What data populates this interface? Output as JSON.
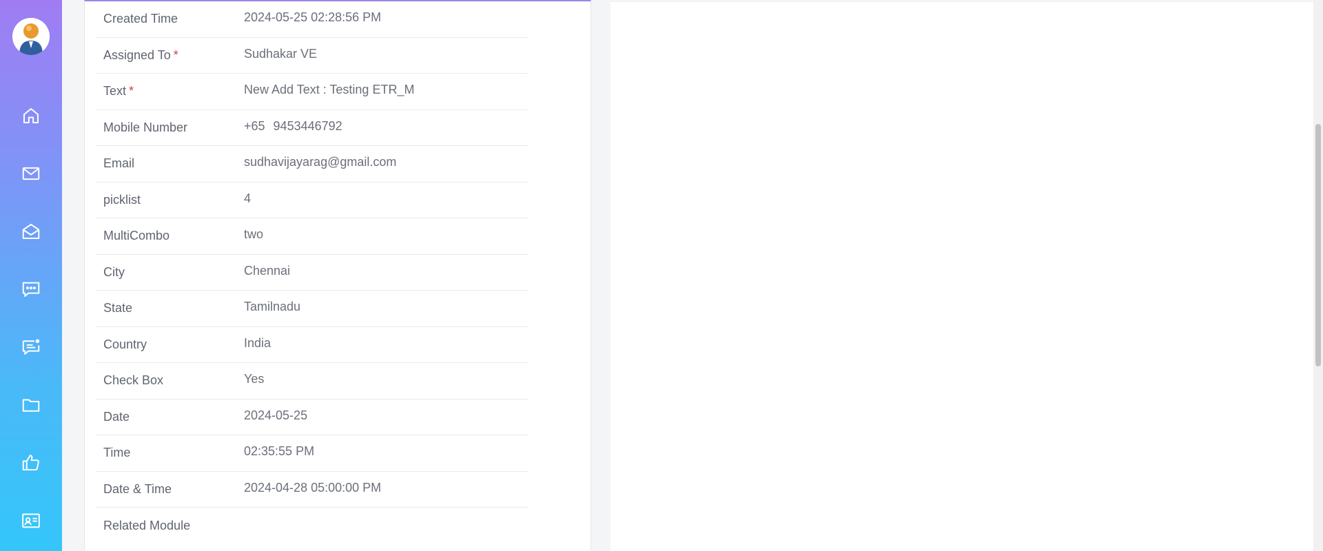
{
  "sidebar": {
    "items": [
      {
        "icon": "home-icon"
      },
      {
        "icon": "mail-icon"
      },
      {
        "icon": "mail-open-icon"
      },
      {
        "icon": "chat-icon"
      },
      {
        "icon": "notification-chat-icon"
      },
      {
        "icon": "folder-icon"
      },
      {
        "icon": "thumbs-up-icon"
      },
      {
        "icon": "contact-card-icon"
      }
    ]
  },
  "details": {
    "rows": [
      {
        "label": "Created Time",
        "required": false,
        "value": "2024-05-25 02:28:56 PM"
      },
      {
        "label": "Assigned To",
        "required": true,
        "value": "Sudhakar VE"
      },
      {
        "label": "Text",
        "required": true,
        "value": "New Add Text : Testing ETR_M"
      },
      {
        "label": "Mobile Number",
        "required": false,
        "code": "+65",
        "value": "9453446792"
      },
      {
        "label": "Email",
        "required": false,
        "value": "sudhavijayarag@gmail.com"
      },
      {
        "label": "picklist",
        "required": false,
        "value": "4"
      },
      {
        "label": "MultiCombo",
        "required": false,
        "value": "two"
      },
      {
        "label": "City",
        "required": false,
        "value": "Chennai"
      },
      {
        "label": "State",
        "required": false,
        "value": "Tamilnadu"
      },
      {
        "label": "Country",
        "required": false,
        "value": "India"
      },
      {
        "label": "Check Box",
        "required": false,
        "value": "Yes"
      },
      {
        "label": "Date",
        "required": false,
        "value": "2024-05-25"
      },
      {
        "label": "Time",
        "required": false,
        "value": "02:35:55 PM"
      },
      {
        "label": "Date & Time",
        "required": false,
        "value": "2024-04-28 05:00:00 PM"
      },
      {
        "label": "Related Module",
        "required": false,
        "value": ""
      }
    ],
    "required_mark": "*"
  },
  "colors": {
    "sidebar_top": "#a07cf3",
    "sidebar_bottom": "#34c6fa",
    "required": "#e0384b",
    "card_accent": "#9c86e6"
  }
}
